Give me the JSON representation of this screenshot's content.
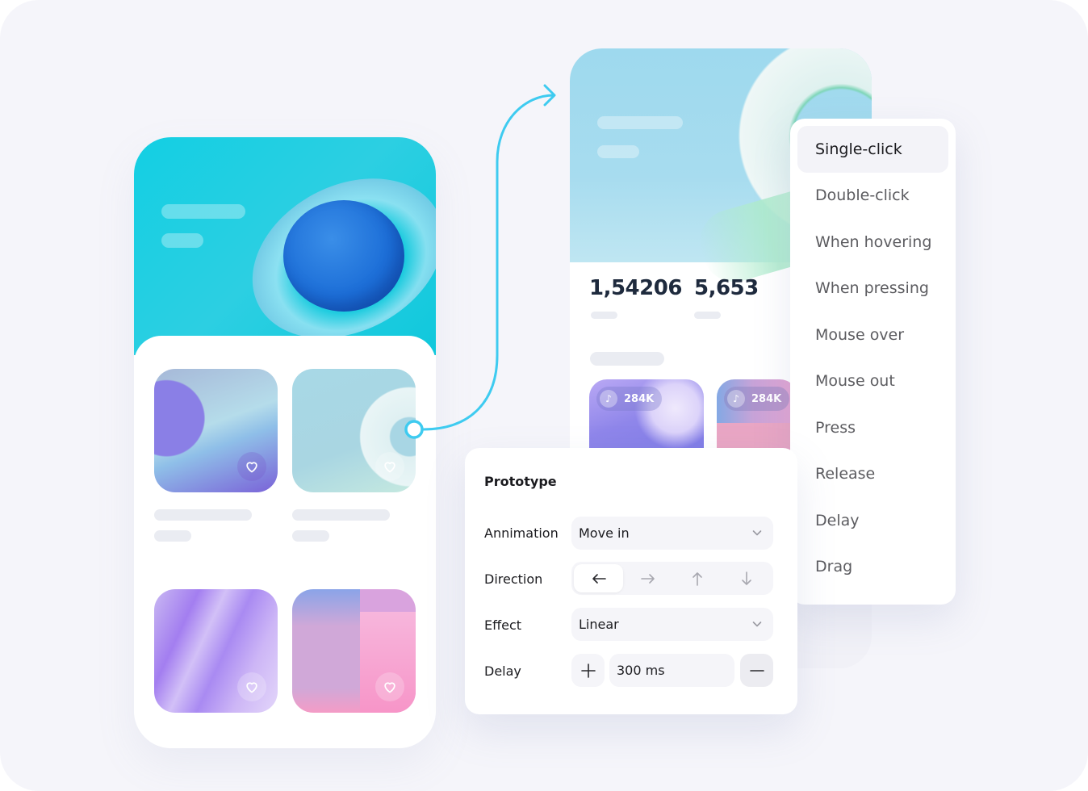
{
  "colors": {
    "background": "#f5f5fa",
    "accent_cyan": "#3ecbf0",
    "text_primary": "#1b1b1f",
    "text_secondary": "#5c5c60",
    "stat_text": "#1e2a3d"
  },
  "left_screen": {
    "cards": [
      {
        "icon": "heart-icon"
      },
      {
        "icon": "heart-icon"
      },
      {
        "icon": "heart-icon"
      },
      {
        "icon": "heart-icon"
      }
    ]
  },
  "right_screen": {
    "stats": [
      {
        "value": "1,54206"
      },
      {
        "value": "5,653"
      }
    ],
    "tracks": [
      {
        "icon": "music-note-icon",
        "count": "284K"
      },
      {
        "icon": "music-note-icon",
        "count": "284K"
      }
    ]
  },
  "trigger_menu": {
    "selected": "Single-click",
    "items": [
      {
        "label": "Single-click"
      },
      {
        "label": "Double-click"
      },
      {
        "label": "When hovering"
      },
      {
        "label": "When pressing"
      },
      {
        "label": "Mouse over"
      },
      {
        "label": "Mouse out"
      },
      {
        "label": "Press"
      },
      {
        "label": "Release"
      },
      {
        "label": "Delay"
      },
      {
        "label": "Drag"
      }
    ]
  },
  "prototype_panel": {
    "title": "Prototype",
    "animation": {
      "label": "Annimation",
      "value": "Move in"
    },
    "direction": {
      "label": "Direction",
      "selected": "left",
      "options": [
        {
          "name": "left",
          "glyph": "←"
        },
        {
          "name": "right",
          "glyph": "→"
        },
        {
          "name": "up",
          "glyph": "↑"
        },
        {
          "name": "down",
          "glyph": "↓"
        }
      ]
    },
    "effect": {
      "label": "Effect",
      "value": "Linear"
    },
    "delay": {
      "label": "Delay",
      "value": "300 ms",
      "increment_glyph": "+",
      "decrement_glyph": "—"
    }
  }
}
